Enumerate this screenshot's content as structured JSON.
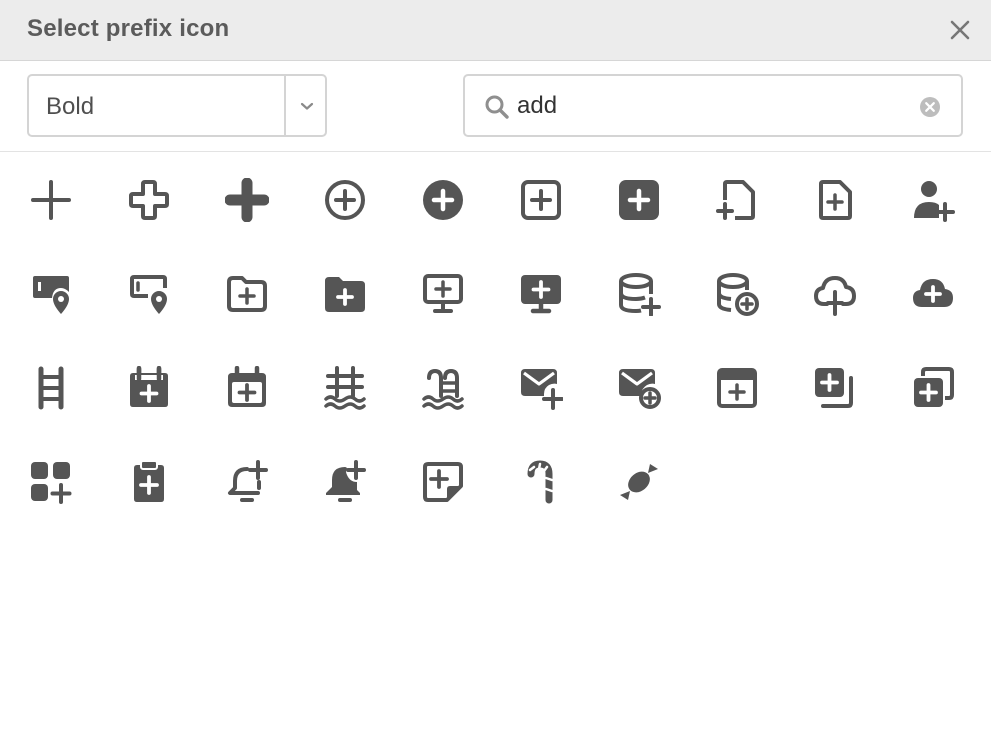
{
  "dialog": {
    "title": "Select prefix icon",
    "close_icon": "close-icon"
  },
  "style_select": {
    "value": "Bold",
    "arrow_icon": "chevron-down-icon"
  },
  "search": {
    "value": "add",
    "icon": "search-icon",
    "clear_icon": "clear-icon"
  },
  "colors": {
    "icon": "#555555",
    "header_bg": "#ececec",
    "border": "#d4d4d4"
  },
  "icons": [
    "plus-icon",
    "plus-outline-icon",
    "plus-bold-icon",
    "plus-circle-icon",
    "plus-circle-filled-icon",
    "plus-square-icon",
    "plus-square-filled-icon",
    "file-add-icon",
    "file-plus-icon",
    "user-add-icon",
    "location-card-filled-icon",
    "location-card-icon",
    "folder-add-icon",
    "folder-add-filled-icon",
    "monitor-add-icon",
    "monitor-add-filled-icon",
    "database-add-icon",
    "database-add-circle-icon",
    "cloud-upload-icon",
    "cloud-add-filled-icon",
    "ladder-icon",
    "calendar-add-filled-icon",
    "calendar-add-icon",
    "pool-ladder-icon",
    "pool-icon",
    "mail-add-icon",
    "mail-add-circle-icon",
    "archive-add-icon",
    "copy-add-icon",
    "duplicate-add-icon",
    "apps-add-icon",
    "clipboard-add-icon",
    "bell-add-icon",
    "bell-add-filled-icon",
    "note-add-icon",
    "candy-cane-icon",
    "candy-icon"
  ]
}
